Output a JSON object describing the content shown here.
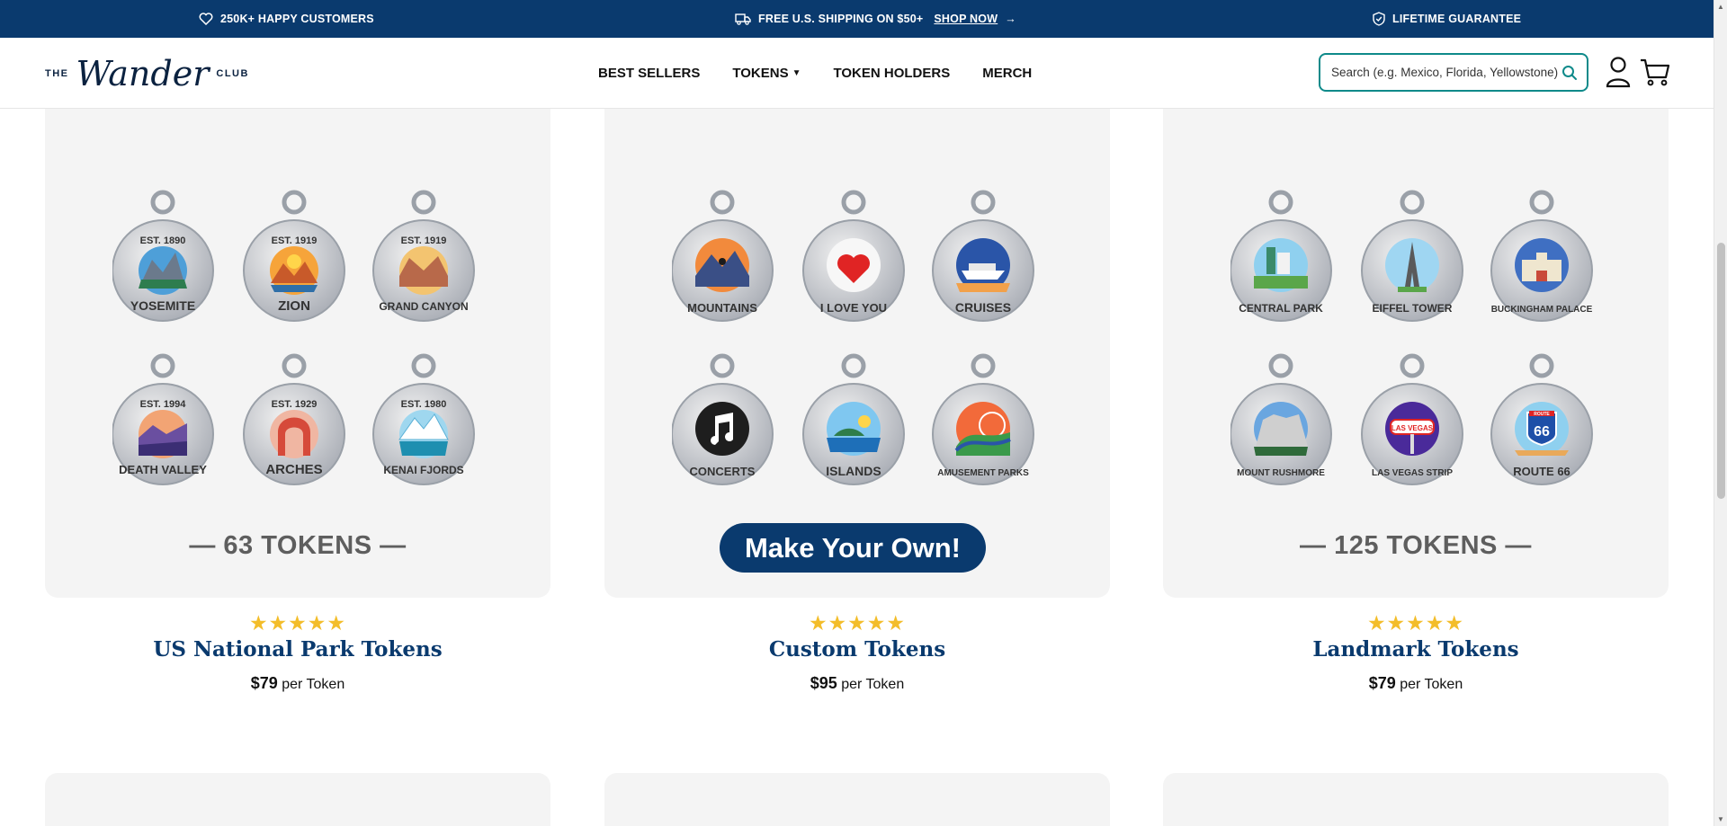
{
  "announcement": {
    "customers": "250K+ HAPPY CUSTOMERS",
    "shipping": "FREE U.S. SHIPPING ON $50+",
    "shop_now": "SHOP NOW",
    "guarantee": "LIFETIME GUARANTEE"
  },
  "logo": {
    "the": "THE",
    "wander": "Wander",
    "club": "CLUB"
  },
  "nav": {
    "best_sellers": "BEST SELLERS",
    "tokens": "TOKENS",
    "token_holders": "TOKEN HOLDERS",
    "merch": "MERCH"
  },
  "search": {
    "placeholder": "Search (e.g. Mexico, Florida, Yellowstone)"
  },
  "products": [
    {
      "title": "US National Park Tokens",
      "price": "$79",
      "unit": "per Token",
      "rating": 5,
      "count_label": "— 63 TOKENS —",
      "tokens": [
        {
          "label": "YOSEMITE",
          "est": "EST. 1890"
        },
        {
          "label": "ZION",
          "est": "EST. 1919"
        },
        {
          "label": "GRAND CANYON",
          "est": "EST. 1919"
        },
        {
          "label": "DEATH VALLEY",
          "est": "EST. 1994"
        },
        {
          "label": "ARCHES",
          "est": "EST. 1929"
        },
        {
          "label": "KENAI FJORDS",
          "est": "EST. 1980"
        }
      ]
    },
    {
      "title": "Custom Tokens",
      "price": "$95",
      "unit": "per Token",
      "rating": 5,
      "button_label": "Make Your Own!",
      "tokens": [
        {
          "label": "MOUNTAINS"
        },
        {
          "label": "I LOVE YOU"
        },
        {
          "label": "CRUISES"
        },
        {
          "label": "CONCERTS"
        },
        {
          "label": "ISLANDS"
        },
        {
          "label": "AMUSEMENT PARKS"
        }
      ]
    },
    {
      "title": "Landmark Tokens",
      "price": "$79",
      "unit": "per Token",
      "rating": 5,
      "count_label": "— 125 TOKENS —",
      "tokens": [
        {
          "label": "CENTRAL PARK"
        },
        {
          "label": "EIFFEL TOWER"
        },
        {
          "label": "BUCKINGHAM PALACE"
        },
        {
          "label": "MOUNT RUSHMORE"
        },
        {
          "label": "LAS VEGAS STRIP",
          "sign": "LAS VEGAS"
        },
        {
          "label": "ROUTE 66",
          "sign": "ROUTE",
          "number": "66"
        }
      ]
    }
  ],
  "colors": {
    "navy": "#0a3a6e",
    "teal": "#0e8a8a",
    "star": "#f3bd2a",
    "card_bg": "#f4f4f4"
  }
}
